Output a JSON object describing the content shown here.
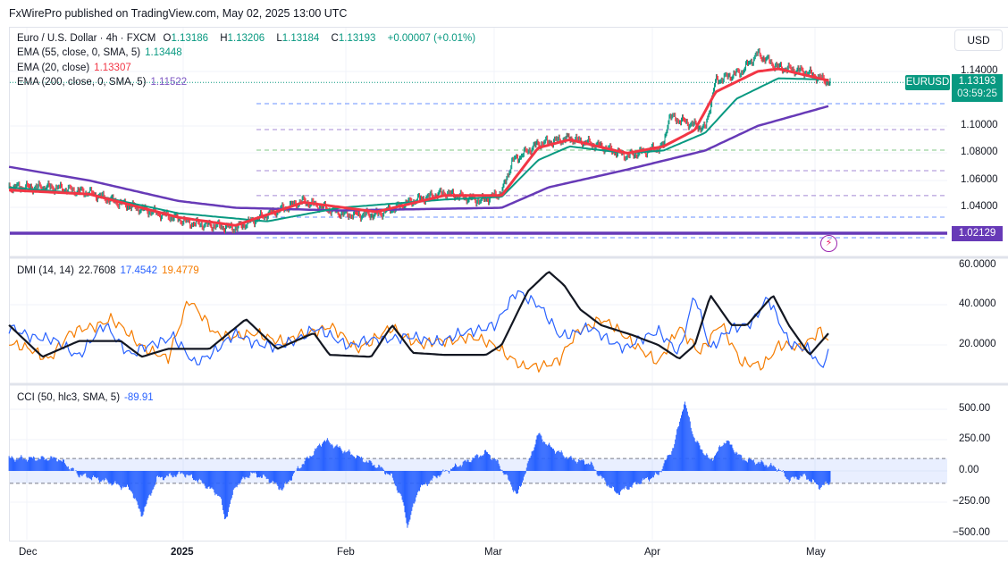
{
  "header": {
    "published": "FxWirePro published on TradingView.com, May 02, 2025 13:00 UTC"
  },
  "legend": {
    "symbol": "Euro / U.S. Dollar · 4h · FXCM",
    "o_label": "O",
    "o": "1.13186",
    "h_label": "H",
    "h": "1.13206",
    "l_label": "L",
    "l": "1.13184",
    "c_label": "C",
    "c": "1.13193",
    "change": "+0.00007 (+0.01%)",
    "ema55_label": "EMA (55, close, 0, SMA, 5)",
    "ema55": "1.13448",
    "ema20_label": "EMA (20, close)",
    "ema20": "1.13307",
    "ema200_label": "EMA (200, close, 0, SMA, 5)",
    "ema200": "1.11522",
    "dmi_label": "DMI (14, 14)",
    "adx": "22.7608",
    "plus_di": "17.4542",
    "minus_di": "19.4779",
    "cci_label": "CCI (50, hlc3, SMA, 5)",
    "cci": "-89.91"
  },
  "price_axis": {
    "currency": "USD",
    "ticks": [
      "1.14000",
      "1.10000",
      "1.08000",
      "1.06000",
      "1.04000"
    ],
    "symbol_tag": "EURUSD",
    "last_price": "1.13193",
    "countdown": "03:59:25",
    "level_tag": "1.02129"
  },
  "dmi_axis": {
    "ticks": [
      "60.0000",
      "40.0000",
      "20.0000"
    ]
  },
  "cci_axis": {
    "ticks": [
      "500.00",
      "250.00",
      "0.00",
      "−250.00",
      "−500.00"
    ]
  },
  "time_axis": {
    "ticks": [
      "Dec",
      "2025",
      "Feb",
      "Mar",
      "Apr",
      "May"
    ]
  },
  "colors": {
    "up": "#089981",
    "down": "#f23645",
    "ema20": "#f23645",
    "ema55": "#089981",
    "ema200": "#673ab7",
    "adx": "#131722",
    "plus_di": "#2962ff",
    "minus_di": "#f57c00",
    "cci": "#2962ff"
  },
  "chart_data": [
    {
      "type": "candlestick",
      "title": "Euro / U.S. Dollar · 4h · FXCM",
      "x_unit": "days since Dec 1 2024",
      "ylim": [
        1.015,
        1.16
      ],
      "close_keypoints": [
        [
          -3.4,
          1.055
        ],
        [
          5,
          1.055
        ],
        [
          12,
          1.051
        ],
        [
          19,
          1.042
        ],
        [
          29,
          1.032
        ],
        [
          31,
          1.029
        ],
        [
          40,
          1.025
        ],
        [
          46,
          1.035
        ],
        [
          53,
          1.045
        ],
        [
          61,
          1.035
        ],
        [
          67,
          1.035
        ],
        [
          74,
          1.045
        ],
        [
          80,
          1.051
        ],
        [
          87,
          1.045
        ],
        [
          91,
          1.051
        ],
        [
          93,
          1.074
        ],
        [
          98,
          1.087
        ],
        [
          104,
          1.091
        ],
        [
          110,
          1.085
        ],
        [
          115,
          1.078
        ],
        [
          122,
          1.085
        ],
        [
          123,
          1.107
        ],
        [
          130,
          1.098
        ],
        [
          132,
          1.133
        ],
        [
          137,
          1.14
        ],
        [
          140,
          1.153
        ],
        [
          144,
          1.143
        ],
        [
          149,
          1.14
        ],
        [
          154,
          1.1319
        ]
      ],
      "ema20_keypoints": [
        [
          -3.4,
          1.053
        ],
        [
          12,
          1.05
        ],
        [
          29,
          1.033
        ],
        [
          40,
          1.027
        ],
        [
          53,
          1.044
        ],
        [
          67,
          1.037
        ],
        [
          80,
          1.049
        ],
        [
          91,
          1.049
        ],
        [
          98,
          1.084
        ],
        [
          104,
          1.09
        ],
        [
          115,
          1.08
        ],
        [
          122,
          1.085
        ],
        [
          128,
          1.097
        ],
        [
          132,
          1.125
        ],
        [
          140,
          1.14
        ],
        [
          144,
          1.142
        ],
        [
          154,
          1.133
        ]
      ],
      "ema55_keypoints": [
        [
          -3.4,
          1.055
        ],
        [
          12,
          1.05
        ],
        [
          29,
          1.036
        ],
        [
          46,
          1.03
        ],
        [
          60,
          1.04
        ],
        [
          80,
          1.046
        ],
        [
          91,
          1.048
        ],
        [
          98,
          1.075
        ],
        [
          104,
          1.085
        ],
        [
          115,
          1.08
        ],
        [
          122,
          1.082
        ],
        [
          130,
          1.095
        ],
        [
          136,
          1.12
        ],
        [
          144,
          1.135
        ],
        [
          154,
          1.134
        ]
      ],
      "ema200_keypoints": [
        [
          -3.4,
          1.07
        ],
        [
          12,
          1.06
        ],
        [
          29,
          1.045
        ],
        [
          40,
          1.04
        ],
        [
          60,
          1.038
        ],
        [
          91,
          1.04
        ],
        [
          100,
          1.055
        ],
        [
          115,
          1.068
        ],
        [
          130,
          1.082
        ],
        [
          140,
          1.1
        ],
        [
          154,
          1.115
        ]
      ],
      "levels": [
        1.1164,
        1.0974,
        1.0823,
        1.0672,
        1.0489,
        1.0331,
        1.018,
        1.02129
      ]
    },
    {
      "type": "line",
      "title": "DMI (14, 14)",
      "ylim": [
        0,
        65
      ],
      "series": [
        {
          "name": "ADX",
          "keypoints": [
            [
              -3.4,
              30
            ],
            [
              3,
              14
            ],
            [
              10,
              22
            ],
            [
              18,
              22
            ],
            [
              22,
              14
            ],
            [
              27,
              18
            ],
            [
              35,
              18
            ],
            [
              42,
              33
            ],
            [
              48,
              18
            ],
            [
              55,
              26
            ],
            [
              58,
              15
            ],
            [
              66,
              14
            ],
            [
              70,
              30
            ],
            [
              74,
              16
            ],
            [
              80,
              15
            ],
            [
              88,
              15
            ],
            [
              91,
              20
            ],
            [
              96,
              47
            ],
            [
              100,
              57
            ],
            [
              103,
              50
            ],
            [
              106,
              38
            ],
            [
              110,
              30
            ],
            [
              116,
              25
            ],
            [
              121,
              20
            ],
            [
              125,
              13
            ],
            [
              128,
              20
            ],
            [
              131,
              45
            ],
            [
              135,
              30
            ],
            [
              138,
              30
            ],
            [
              143,
              45
            ],
            [
              146,
              30
            ],
            [
              150,
              15
            ],
            [
              154,
              27
            ],
            [
              156,
              22
            ]
          ]
        },
        {
          "name": "+DI",
          "keypoints": [
            [
              -3.4,
              28
            ],
            [
              5,
              22
            ],
            [
              10,
              15
            ],
            [
              15,
              30
            ],
            [
              20,
              15
            ],
            [
              28,
              25
            ],
            [
              32,
              10
            ],
            [
              40,
              25
            ],
            [
              48,
              18
            ],
            [
              55,
              28
            ],
            [
              62,
              20
            ],
            [
              70,
              24
            ],
            [
              80,
              22
            ],
            [
              86,
              28
            ],
            [
              90,
              30
            ],
            [
              94,
              48
            ],
            [
              98,
              40
            ],
            [
              102,
              25
            ],
            [
              108,
              28
            ],
            [
              115,
              18
            ],
            [
              121,
              28
            ],
            [
              125,
              15
            ],
            [
              128,
              46
            ],
            [
              131,
              18
            ],
            [
              135,
              28
            ],
            [
              139,
              32
            ],
            [
              142,
              43
            ],
            [
              146,
              22
            ],
            [
              150,
              17
            ],
            [
              152,
              8
            ],
            [
              154,
              17
            ]
          ]
        },
        {
          "name": "−DI",
          "keypoints": [
            [
              -3.4,
              22
            ],
            [
              4,
              13
            ],
            [
              8,
              25
            ],
            [
              16,
              33
            ],
            [
              22,
              20
            ],
            [
              27,
              12
            ],
            [
              31,
              44
            ],
            [
              36,
              25
            ],
            [
              44,
              25
            ],
            [
              50,
              22
            ],
            [
              58,
              30
            ],
            [
              63,
              18
            ],
            [
              70,
              28
            ],
            [
              76,
              20
            ],
            [
              84,
              24
            ],
            [
              90,
              20
            ],
            [
              95,
              8
            ],
            [
              102,
              12
            ],
            [
              106,
              28
            ],
            [
              110,
              33
            ],
            [
              116,
              22
            ],
            [
              121,
              10
            ],
            [
              125,
              30
            ],
            [
              129,
              15
            ],
            [
              133,
              32
            ],
            [
              137,
              10
            ],
            [
              141,
              10
            ],
            [
              144,
              20
            ],
            [
              148,
              18
            ],
            [
              152,
              28
            ],
            [
              154,
              20
            ]
          ]
        }
      ]
    },
    {
      "type": "histogram",
      "title": "CCI (50, hlc3, SMA, 5)",
      "ylim": [
        -560,
        580
      ],
      "keypoints": [
        [
          -3.4,
          100
        ],
        [
          6,
          100
        ],
        [
          10,
          -30
        ],
        [
          15,
          -80
        ],
        [
          20,
          -150
        ],
        [
          22,
          -360
        ],
        [
          25,
          -60
        ],
        [
          30,
          -20
        ],
        [
          33,
          -80
        ],
        [
          37,
          -200
        ],
        [
          38,
          -400
        ],
        [
          40,
          -120
        ],
        [
          43,
          -20
        ],
        [
          46,
          -60
        ],
        [
          49,
          -150
        ],
        [
          52,
          20
        ],
        [
          55,
          150
        ],
        [
          57,
          250
        ],
        [
          60,
          180
        ],
        [
          64,
          100
        ],
        [
          68,
          20
        ],
        [
          70,
          -50
        ],
        [
          72,
          -240
        ],
        [
          73,
          -450
        ],
        [
          75,
          -150
        ],
        [
          79,
          -30
        ],
        [
          83,
          50
        ],
        [
          88,
          150
        ],
        [
          90,
          80
        ],
        [
          92,
          -50
        ],
        [
          94,
          -200
        ],
        [
          96,
          50
        ],
        [
          98,
          300
        ],
        [
          100,
          200
        ],
        [
          104,
          100
        ],
        [
          108,
          60
        ],
        [
          110,
          -50
        ],
        [
          113,
          -180
        ],
        [
          118,
          -80
        ],
        [
          121,
          -30
        ],
        [
          124,
          200
        ],
        [
          126,
          560
        ],
        [
          128,
          250
        ],
        [
          131,
          80
        ],
        [
          134,
          250
        ],
        [
          137,
          100
        ],
        [
          141,
          60
        ],
        [
          144,
          20
        ],
        [
          146,
          -70
        ],
        [
          149,
          -40
        ],
        [
          152,
          -130
        ],
        [
          154,
          -90
        ]
      ]
    }
  ]
}
